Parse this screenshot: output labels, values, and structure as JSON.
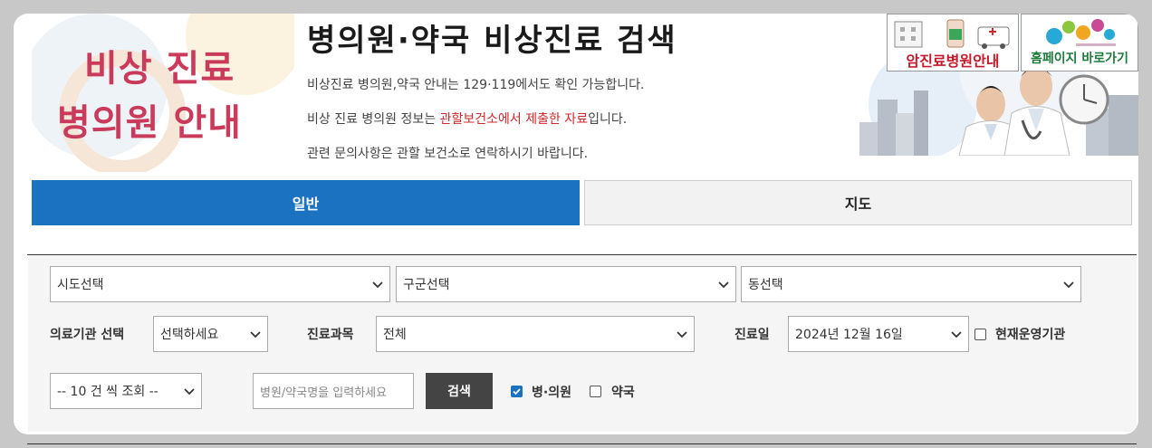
{
  "banner": {
    "line1": "비상 진료",
    "line2": "병의원 안내"
  },
  "header": {
    "title": "병의원·약국 비상진료 검색",
    "info1": "비상진료 병의원,약국 안내는 129·119에서도 확인 가능합니다.",
    "info2_prefix": "비상 진료 병의원 정보는 ",
    "info2_highlight": "관할보건소에서 제출한 자료",
    "info2_suffix": "입니다.",
    "info3": "관련 문의사항은 관할 보건소로 연락하시기 바랍니다."
  },
  "promos": {
    "cancer_link": "암진료병원안내",
    "home_link": "홈페이지 바로가기"
  },
  "tabs": [
    {
      "label": "일반",
      "active": true
    },
    {
      "label": "지도",
      "active": false
    }
  ],
  "filters": {
    "sido": "시도선택",
    "gugun": "구군선택",
    "dong": "동선택",
    "institution_label": "의료기관 선택",
    "institution_value": "선택하세요",
    "department_label": "진료과목",
    "department_value": "전체",
    "date_label": "진료일",
    "date_value": "2024년 12월 16일",
    "operating_label": "현재운영기관",
    "operating_checked": false,
    "page_size": "-- 10 건 씩 조회 --",
    "search_placeholder": "병원/약국명을 입력하세요",
    "search_button": "검색",
    "hospital_label": "병·의원",
    "hospital_checked": true,
    "pharmacy_label": "약국",
    "pharmacy_checked": false
  },
  "colors": {
    "accent": "#1b72c0",
    "banner_pink": "#c93a5b",
    "highlight_red": "#d0282b",
    "cancer_red": "#c41a2b",
    "home_green": "#1e7a3a"
  }
}
